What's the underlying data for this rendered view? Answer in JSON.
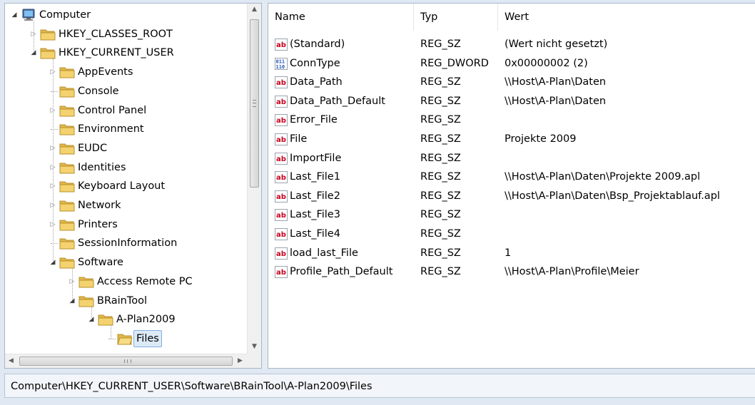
{
  "tree": {
    "items": [
      {
        "label": "Computer",
        "icon": "computer-icon",
        "depth": 0,
        "expander": "expanded"
      },
      {
        "label": "HKEY_CLASSES_ROOT",
        "icon": "folder-icon",
        "depth": 1,
        "expander": "collapsed"
      },
      {
        "label": "HKEY_CURRENT_USER",
        "icon": "folder-icon",
        "depth": 1,
        "expander": "expanded"
      },
      {
        "label": "AppEvents",
        "icon": "folder-icon",
        "depth": 2,
        "expander": "collapsed"
      },
      {
        "label": "Console",
        "icon": "folder-icon",
        "depth": 2,
        "expander": "none"
      },
      {
        "label": "Control Panel",
        "icon": "folder-icon",
        "depth": 2,
        "expander": "collapsed"
      },
      {
        "label": "Environment",
        "icon": "folder-icon",
        "depth": 2,
        "expander": "none"
      },
      {
        "label": "EUDC",
        "icon": "folder-icon",
        "depth": 2,
        "expander": "collapsed"
      },
      {
        "label": "Identities",
        "icon": "folder-icon",
        "depth": 2,
        "expander": "collapsed"
      },
      {
        "label": "Keyboard Layout",
        "icon": "folder-icon",
        "depth": 2,
        "expander": "collapsed"
      },
      {
        "label": "Network",
        "icon": "folder-icon",
        "depth": 2,
        "expander": "collapsed"
      },
      {
        "label": "Printers",
        "icon": "folder-icon",
        "depth": 2,
        "expander": "collapsed"
      },
      {
        "label": "SessionInformation",
        "icon": "folder-icon",
        "depth": 2,
        "expander": "none"
      },
      {
        "label": "Software",
        "icon": "folder-icon",
        "depth": 2,
        "expander": "expanded"
      },
      {
        "label": "Access Remote PC",
        "icon": "folder-icon",
        "depth": 3,
        "expander": "collapsed"
      },
      {
        "label": "BRainTool",
        "icon": "folder-icon",
        "depth": 3,
        "expander": "expanded"
      },
      {
        "label": "A-Plan2009",
        "icon": "folder-icon",
        "depth": 4,
        "expander": "expanded"
      },
      {
        "label": "Files",
        "icon": "folder-open-icon",
        "depth": 5,
        "expander": "none",
        "selected": true
      }
    ]
  },
  "values": {
    "columns": [
      "Name",
      "Typ",
      "Wert"
    ],
    "rows": [
      {
        "name": "(Standard)",
        "type": "REG_SZ",
        "value": "(Wert nicht gesetzt)",
        "icon": "string-value-icon"
      },
      {
        "name": "ConnType",
        "type": "REG_DWORD",
        "value": "0x00000002 (2)",
        "icon": "dword-value-icon"
      },
      {
        "name": "Data_Path",
        "type": "REG_SZ",
        "value": "\\\\Host\\A-Plan\\Daten",
        "icon": "string-value-icon"
      },
      {
        "name": "Data_Path_Default",
        "type": "REG_SZ",
        "value": "\\\\Host\\A-Plan\\Daten",
        "icon": "string-value-icon"
      },
      {
        "name": "Error_File",
        "type": "REG_SZ",
        "value": "",
        "icon": "string-value-icon"
      },
      {
        "name": "File",
        "type": "REG_SZ",
        "value": "Projekte 2009",
        "icon": "string-value-icon"
      },
      {
        "name": "ImportFile",
        "type": "REG_SZ",
        "value": "",
        "icon": "string-value-icon"
      },
      {
        "name": "Last_File1",
        "type": "REG_SZ",
        "value": "\\\\Host\\A-Plan\\Daten\\Projekte 2009.apl",
        "icon": "string-value-icon"
      },
      {
        "name": "Last_File2",
        "type": "REG_SZ",
        "value": "\\\\Host\\A-Plan\\Daten\\Bsp_Projektablauf.apl",
        "icon": "string-value-icon"
      },
      {
        "name": "Last_File3",
        "type": "REG_SZ",
        "value": "",
        "icon": "string-value-icon"
      },
      {
        "name": "Last_File4",
        "type": "REG_SZ",
        "value": "",
        "icon": "string-value-icon"
      },
      {
        "name": "load_last_File",
        "type": "REG_SZ",
        "value": "1",
        "icon": "string-value-icon"
      },
      {
        "name": "Profile_Path_Default",
        "type": "REG_SZ",
        "value": "\\\\Host\\A-Plan\\Profile\\Meier",
        "icon": "string-value-icon"
      }
    ]
  },
  "status_bar": {
    "path": "Computer\\HKEY_CURRENT_USER\\Software\\BRainTool\\A-Plan2009\\Files"
  },
  "scrollbar": {
    "up_arrow": "▲",
    "down_arrow": "▼",
    "left_arrow": "◀",
    "right_arrow": "▶"
  },
  "colors": {
    "selection_fill": "#dceaf7",
    "selection_border": "#84acdd",
    "folder": "#e9c35a",
    "string_icon_red": "#c8001e",
    "dword_icon_blue": "#2456b8"
  }
}
